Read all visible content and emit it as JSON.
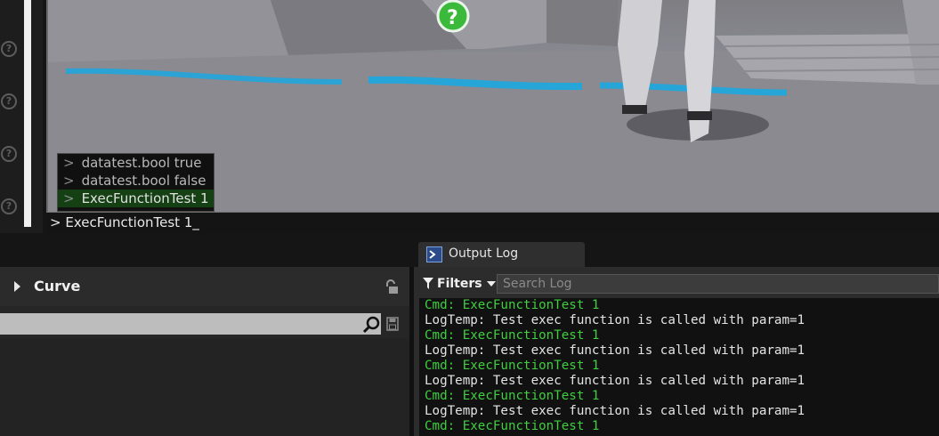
{
  "console": {
    "input_text": "> ExecFunctionTest 1_",
    "suggestions": [
      {
        "label": "datatest.bool true",
        "selected": false
      },
      {
        "label": "datatest.bool false",
        "selected": false
      },
      {
        "label": "ExecFunctionTest 1",
        "selected": true
      }
    ],
    "suggestion_marker": ">"
  },
  "curve_panel": {
    "title": "Curve",
    "search_value": ""
  },
  "output_log": {
    "tab_label": "Output Log",
    "filters_label": "Filters",
    "search_placeholder": "Search Log",
    "lines": [
      {
        "kind": "cmd",
        "text": "Cmd: ExecFunctionTest 1"
      },
      {
        "kind": "temp",
        "text": "LogTemp: Test exec function is called with param=1"
      },
      {
        "kind": "cmd",
        "text": "Cmd: ExecFunctionTest 1"
      },
      {
        "kind": "temp",
        "text": "LogTemp: Test exec function is called with param=1"
      },
      {
        "kind": "cmd",
        "text": "Cmd: ExecFunctionTest 1"
      },
      {
        "kind": "temp",
        "text": "LogTemp: Test exec function is called with param=1"
      },
      {
        "kind": "cmd",
        "text": "Cmd: ExecFunctionTest 1"
      },
      {
        "kind": "temp",
        "text": "LogTemp: Test exec function is called with param=1"
      },
      {
        "kind": "cmd",
        "text": "Cmd: ExecFunctionTest 1"
      }
    ]
  },
  "icons": {
    "help": "question-circle-icon",
    "lock": "lock-icon",
    "search": "magnifier-icon",
    "save": "save-icon",
    "log_tab": "terminal-icon",
    "filter": "funnel-icon",
    "expand": "triangle-right-icon"
  },
  "colors": {
    "cmd_text": "#3fcf3f",
    "log_text": "#e4e4e4",
    "selected_suggestion": "#144014",
    "floor_text": "#1aa7e0"
  }
}
